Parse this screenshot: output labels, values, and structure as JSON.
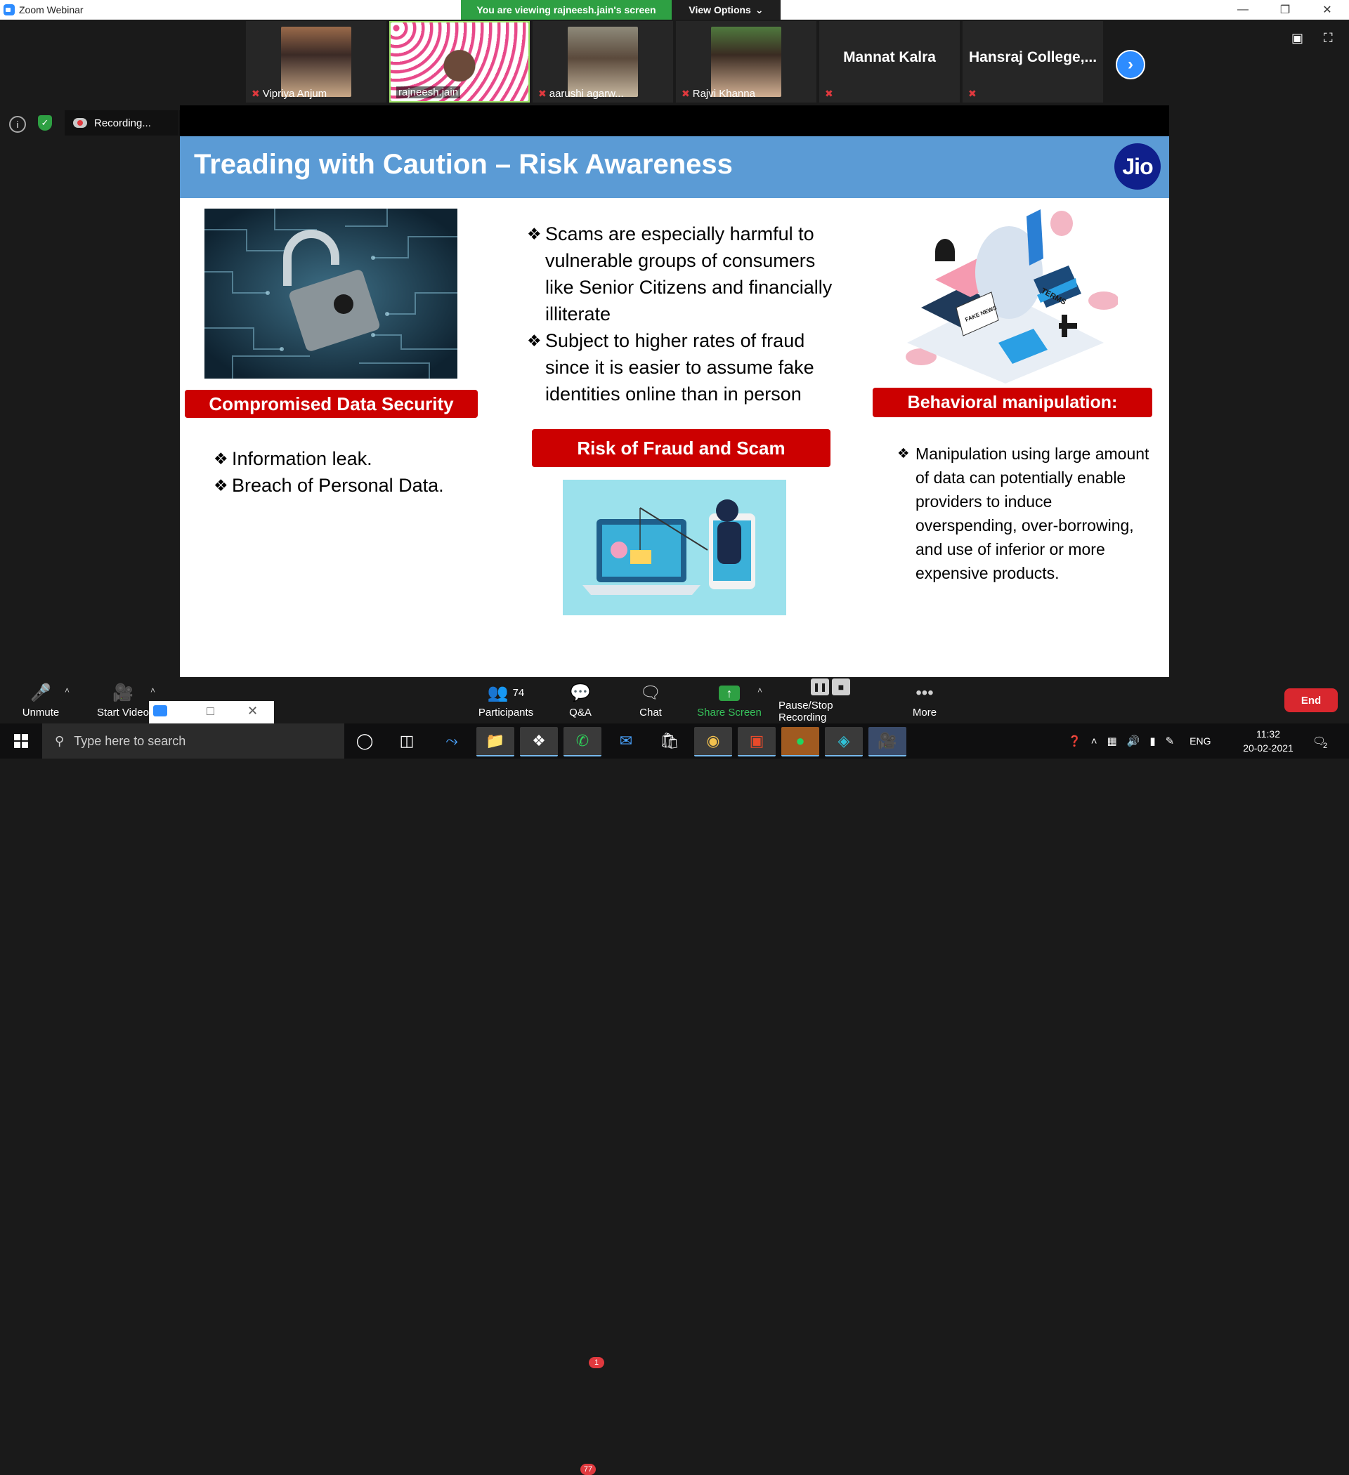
{
  "titlebar": {
    "title": "Zoom Webinar"
  },
  "banner": {
    "viewing": "You are viewing rajneesh.jain's screen",
    "view_options": "View Options"
  },
  "participants_strip": [
    {
      "name": "Vipriya Anjum",
      "muted": true
    },
    {
      "name": "rajneesh.jain",
      "muted": false
    },
    {
      "name": "aarushi agarw...",
      "muted": true
    },
    {
      "name": "Rajvi Khanna",
      "muted": true
    },
    {
      "name": "Mannat Kalra",
      "muted": true
    },
    {
      "name": "Hansraj  College,...",
      "muted": true
    }
  ],
  "recording": {
    "label": "Recording..."
  },
  "slide": {
    "title": "Treading with Caution – Risk Awareness",
    "logo": "Jio",
    "left": {
      "label": "Compromised Data Security",
      "bullets": [
        "Information leak.",
        "Breach of Personal Data."
      ]
    },
    "center": {
      "bullets": [
        "Scams are especially harmful to vulnerable groups of consumers like Senior Citizens and financially illiterate",
        "Subject to higher rates of fraud since it is easier to assume fake identities online than in person"
      ],
      "label": "Risk of Fraud and Scam"
    },
    "right": {
      "label": "Behavioral manipulation:",
      "bullets": [
        "Manipulation using large amount of data can potentially enable providers to induce overspending, over-borrowing, and use of inferior or more expensive products."
      ],
      "illus_terms": "TERMS",
      "illus_news": "FAKE NEWS"
    }
  },
  "toolbar": {
    "unmute": "Unmute",
    "start_video": "Start Video",
    "participants": "Participants",
    "participants_count": "74",
    "qa": "Q&A",
    "qa_badge": "1",
    "chat": "Chat",
    "share_screen": "Share Screen",
    "pause_stop": "Pause/Stop Recording",
    "more": "More",
    "end": "End"
  },
  "taskbar": {
    "search_placeholder": "Type here to search",
    "whatsapp_badge": "77",
    "language": "ENG",
    "time": "11:32",
    "date": "20-02-2021",
    "notifications": "2"
  }
}
